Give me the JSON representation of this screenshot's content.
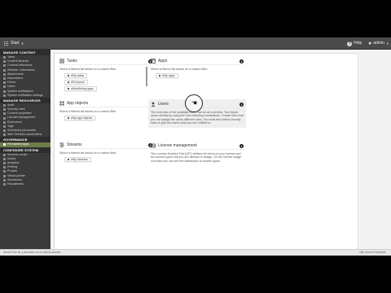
{
  "topbar": {
    "home_label": "Start",
    "help_label": "Help",
    "user_label": "admin"
  },
  "sidebar": {
    "sections": [
      {
        "title": "Manage content",
        "items": [
          {
            "label": "Tasks"
          },
          {
            "label": "Content libraries"
          },
          {
            "label": "Content collections"
          },
          {
            "label": "Website / information"
          },
          {
            "label": "Attachments"
          },
          {
            "label": "Discussions"
          },
          {
            "label": "Forms"
          },
          {
            "label": "Users"
          },
          {
            "label": "System notifications"
          },
          {
            "label": "System notification settings"
          }
        ]
      },
      {
        "title": "Manage resources",
        "items": [
          {
            "label": "Audit"
          },
          {
            "label": "Security roles"
          },
          {
            "label": "Content properties"
          },
          {
            "label": "License management"
          },
          {
            "label": "Extensions"
          },
          {
            "label": "Tags"
          },
          {
            "label": "Scheduled job service"
          },
          {
            "label": "Web Services connections"
          }
        ]
      },
      {
        "title": "Governance",
        "items": [
          {
            "label": "Permanent apps",
            "active": true
          }
        ]
      },
      {
        "title": "Configure system",
        "items": [
          {
            "label": "Services center"
          },
          {
            "label": "Nodes"
          },
          {
            "label": "Analytics"
          },
          {
            "label": "Printing"
          },
          {
            "label": "Proxies"
          },
          {
            "label": "Virtual pointer"
          },
          {
            "label": "Schedulers"
          },
          {
            "label": "Repositories"
          }
        ]
      }
    ]
  },
  "cards": {
    "tasks": {
      "title": "Tasks",
      "icon": "list-icon",
      "desc": "Select a filtered list based on a custom filter.",
      "chips": [
        "eMy tasks",
        "eEveryone",
        "eMonitoring apps"
      ]
    },
    "apps": {
      "title": "Apps",
      "icon": "apps-icon",
      "desc": "Select a filtered list based on a custom filter.",
      "chips": [
        "eMy apps"
      ]
    },
    "appobjects": {
      "title": "App objects",
      "icon": "objects-icon",
      "desc": "Select a filtered list based on a custom filter.",
      "chips": [
        "eMy app objects"
      ]
    },
    "users": {
      "title": "Users",
      "icon": "user-icon",
      "desc": "The overview of the available users can be an overview. You import users directly by using the User directory connections. Create roles that you can assign the users different roles. You must also follow security roles to give the users what you are entitled to."
    },
    "streams": {
      "title": "Streams",
      "icon": "stream-icon",
      "desc": "Select a filtered list based on a custom filter.",
      "chips": [
        "eMy streams"
      ]
    },
    "license": {
      "title": "License management",
      "icon": "license-icon",
      "desc": "The License Enabled Flat (LEF) defines the terms of your license and the access types that you are allowed to assign. On the license usage overview you can see the distribution of access types."
    }
  },
  "statusbar": {
    "left": "Sense Hub for y-decluster-a4-ct-clients-access",
    "right": "Qlik Sense Enterprise"
  },
  "colors": {
    "topbar": "#4a4a4a",
    "sidebar": "#3b3b3b",
    "active_item": "#6f7d4a"
  }
}
